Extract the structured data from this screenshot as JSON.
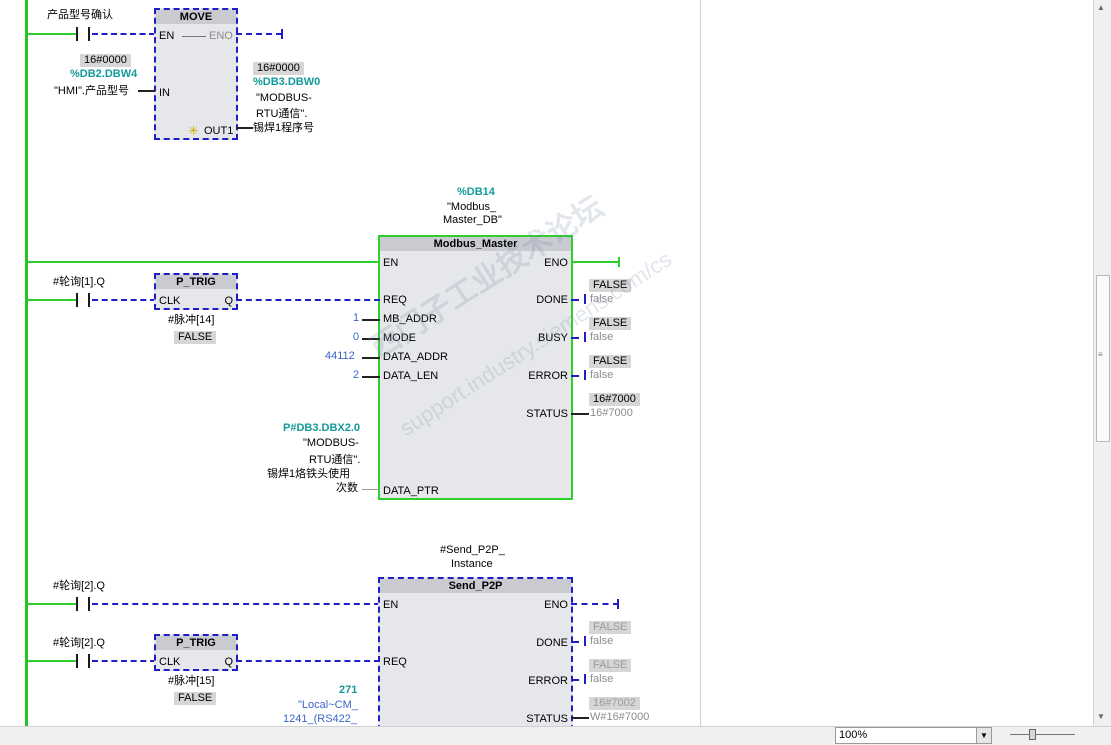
{
  "network1": {
    "top_label": "产品型号确认",
    "move_title": "MOVE",
    "pin_en": "EN",
    "pin_eno": "ENO",
    "pin_in": "IN",
    "pin_out1": "OUT1",
    "in_value": "16#0000",
    "in_address": "%DB2.DBW4",
    "in_symbol": "\"HMI\".产品型号",
    "out_value": "16#0000",
    "out_address": "%DB3.DBW0",
    "out_symbol_1": "\"MODBUS-",
    "out_symbol_2": "RTU通信\".",
    "out_symbol_3": "锡焊1程序号"
  },
  "network2": {
    "db_address": "%DB14",
    "db_name_1": "\"Modbus_",
    "db_name_2": "Master_DB\"",
    "block_title": "Modbus_Master",
    "contact_label": "#轮询[1].Q",
    "ptrig_title": "P_TRIG",
    "ptrig_clk": "CLK",
    "ptrig_q": "Q",
    "ptrig_mem": "#脉冲[14]",
    "ptrig_state": "FALSE",
    "inputs": [
      {
        "pin": "EN",
        "value": ""
      },
      {
        "pin": "REQ",
        "value": ""
      },
      {
        "pin": "MB_ADDR",
        "value": "1"
      },
      {
        "pin": "MODE",
        "value": "0"
      },
      {
        "pin": "DATA_ADDR",
        "value": "44112"
      },
      {
        "pin": "DATA_LEN",
        "value": "2"
      },
      {
        "pin": "DATA_PTR",
        "value": ""
      }
    ],
    "outputs": [
      {
        "pin": "ENO"
      },
      {
        "pin": "DONE",
        "box": "FALSE",
        "live": "false"
      },
      {
        "pin": "BUSY",
        "box": "FALSE",
        "live": "false"
      },
      {
        "pin": "ERROR",
        "box": "FALSE",
        "live": "false"
      },
      {
        "pin": "STATUS",
        "box": "16#7000",
        "live": "16#7000"
      }
    ],
    "ptr_address": "P#DB3.DBX2.0",
    "ptr_symbol_1": "\"MODBUS-",
    "ptr_symbol_2": "RTU通信\".",
    "ptr_symbol_3": "锡焊1烙铁头使用",
    "ptr_symbol_4": "次数"
  },
  "network3": {
    "instance_1": "#Send_P2P_",
    "instance_2": "Instance",
    "block_title": "Send_P2P",
    "contact1_label": "#轮询[2].Q",
    "contact2_label": "#轮询[2].Q",
    "ptrig_title": "P_TRIG",
    "ptrig_clk": "CLK",
    "ptrig_q": "Q",
    "ptrig_mem": "#脉冲[15]",
    "ptrig_state": "FALSE",
    "pin_en": "EN",
    "pin_req": "REQ",
    "pin_eno": "ENO",
    "outputs": [
      {
        "pin": "DONE",
        "box": "FALSE",
        "live": "false"
      },
      {
        "pin": "ERROR",
        "box": "FALSE",
        "live": "false"
      },
      {
        "pin": "STATUS",
        "box": "16#7002",
        "live": "W#16#7000"
      }
    ],
    "port_value": "271",
    "port_symbol_1": "\"Local~CM_",
    "port_symbol_2": "1241_(RS422_"
  },
  "watermark": {
    "line1": "西门子工业",
    "line2": "support.industry.siemens.com/cs",
    "line3": "技术论坛"
  },
  "statusbar": {
    "zoom": "100%"
  }
}
